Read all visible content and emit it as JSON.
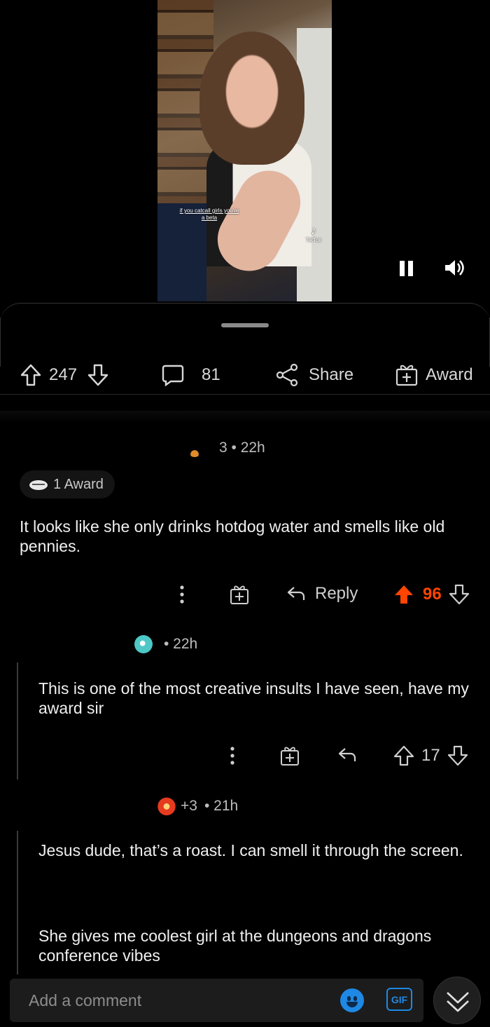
{
  "video": {
    "caption": "if you catcall girls you're a beta",
    "watermark": "TikTok"
  },
  "actions": {
    "votes": "247",
    "comments": "81",
    "share_label": "Share",
    "award_label": "Award"
  },
  "comments": [
    {
      "time": "3 • 22h",
      "award": "1 Award",
      "body": "It looks like she only drinks hotdog water and smells like old pennies.",
      "reply_label": "Reply",
      "score": "96",
      "upvoted": true
    },
    {
      "time": "• 22h",
      "body": "This is one of the most creative insults I have seen, have my award sir",
      "score": "17"
    },
    {
      "awards_extra": "+3",
      "time": "• 21h",
      "body": "Jesus dude, that’s a roast.  I can smell it through the screen.",
      "body2": "She gives me coolest girl at the dungeons and dragons conference vibes"
    }
  ],
  "composer": {
    "placeholder": "Add a comment",
    "gif_label": "GIF"
  },
  "colors": {
    "accent": "#ff4500",
    "link": "#1e88e5"
  }
}
